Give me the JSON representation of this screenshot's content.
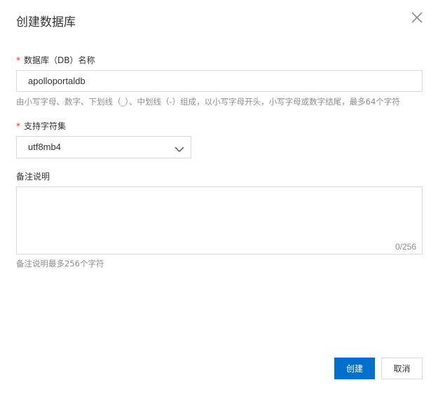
{
  "dialog": {
    "title": "创建数据库",
    "close_icon": "close-icon"
  },
  "form": {
    "db_name": {
      "required_mark": "*",
      "label": "数据库（DB）名称",
      "value": "apolloportaldb",
      "help": "由小写字母、数字、下划线（_）、中划线（-）组成，以小写字母开头，小写字母或数字结尾，最多64个字符"
    },
    "charset": {
      "required_mark": "*",
      "label": "支持字符集",
      "selected": "utf8mb4",
      "icon": "chevron-down-icon"
    },
    "remark": {
      "label": "备注说明",
      "value": "",
      "counter": "0/256",
      "help": "备注说明最多256个字符"
    }
  },
  "footer": {
    "create_label": "创建",
    "cancel_label": "取消"
  },
  "colors": {
    "primary": "#0070cc",
    "required": "#e03131",
    "border": "#d9d9d9",
    "help_text": "#8c8c8c"
  }
}
